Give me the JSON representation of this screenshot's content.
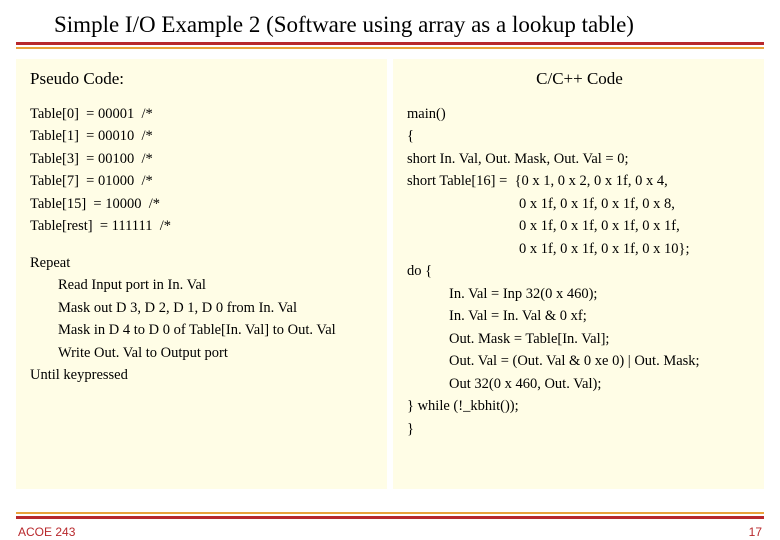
{
  "title": "Simple I/O Example 2 (Software using array as a lookup table)",
  "left": {
    "heading": "Pseudo Code:",
    "table_lines": [
      "Table[0]  = 00001  /*",
      "Table[1]  = 00010  /*",
      "Table[3]  = 00100  /*",
      "Table[7]  = 01000  /*",
      "Table[15]  = 10000  /*",
      "Table[rest]  = 111111  /*"
    ],
    "loop": {
      "repeat": "Repeat",
      "body": [
        "Read Input port in In. Val",
        "Mask out D 3, D 2, D 1, D 0 from In. Val",
        "Mask in D 4 to D 0 of Table[In. Val] to Out. Val",
        "Write Out. Val to Output port"
      ],
      "until": "Until keypressed"
    }
  },
  "right": {
    "heading": "C/C++ Code",
    "lines_top": [
      "main()",
      "{",
      "short In. Val, Out. Mask, Out. Val = 0;",
      "short Table[16] =  {0 x 1, 0 x 2, 0 x 1f, 0 x 4,"
    ],
    "lines_cont": [
      "0 x 1f, 0 x 1f, 0 x 1f, 0 x 8,",
      "0 x 1f, 0 x 1f, 0 x 1f, 0 x 1f,",
      "0 x 1f, 0 x 1f, 0 x 1f, 0 x 10};"
    ],
    "do": "do {",
    "do_body": [
      "In. Val = Inp 32(0 x 460);",
      "In. Val = In. Val & 0 xf;",
      "Out. Mask = Table[In. Val];",
      "Out. Val = (Out. Val & 0 xe 0) | Out. Mask;",
      "Out 32(0 x 460, Out. Val);"
    ],
    "while": "} while (!_kbhit());",
    "end": "}"
  },
  "footer": {
    "left": "ACOE 243",
    "right": "17"
  }
}
